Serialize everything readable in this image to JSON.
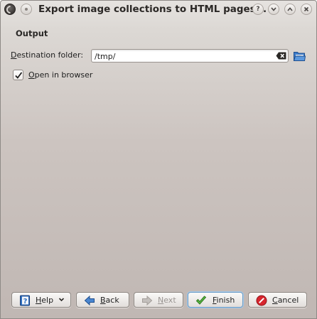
{
  "window": {
    "title": "Export image collections to HTML pages..."
  },
  "page": {
    "section_title": "Output",
    "destination": {
      "label_first": "D",
      "label_rest": "estination folder:",
      "value": "/tmp/"
    },
    "open_in_browser": {
      "label_first": "O",
      "label_rest": "pen in browser",
      "checked": true
    }
  },
  "buttons": {
    "help": {
      "first": "H",
      "rest": "elp"
    },
    "back": {
      "first": "B",
      "rest": "ack"
    },
    "next": {
      "first": "N",
      "rest": "ext",
      "enabled": false
    },
    "finish": {
      "first": "F",
      "rest": "inish"
    },
    "cancel": {
      "first": "C",
      "rest": "ancel"
    }
  },
  "colors": {
    "accent_blue": "#2f6fc0",
    "finish_green": "#3a9a2a",
    "cancel_red": "#c8202a"
  },
  "icons": {
    "titlebar": [
      "app-menu-icon",
      "pin-icon",
      "help-icon",
      "minimize-icon",
      "maximize-icon",
      "close-icon"
    ],
    "input": [
      "clear-text-icon",
      "folder-open-icon"
    ],
    "buttons": [
      "help-book-icon",
      "back-arrow-icon",
      "next-arrow-icon",
      "finish-check-icon",
      "cancel-stop-icon"
    ]
  }
}
